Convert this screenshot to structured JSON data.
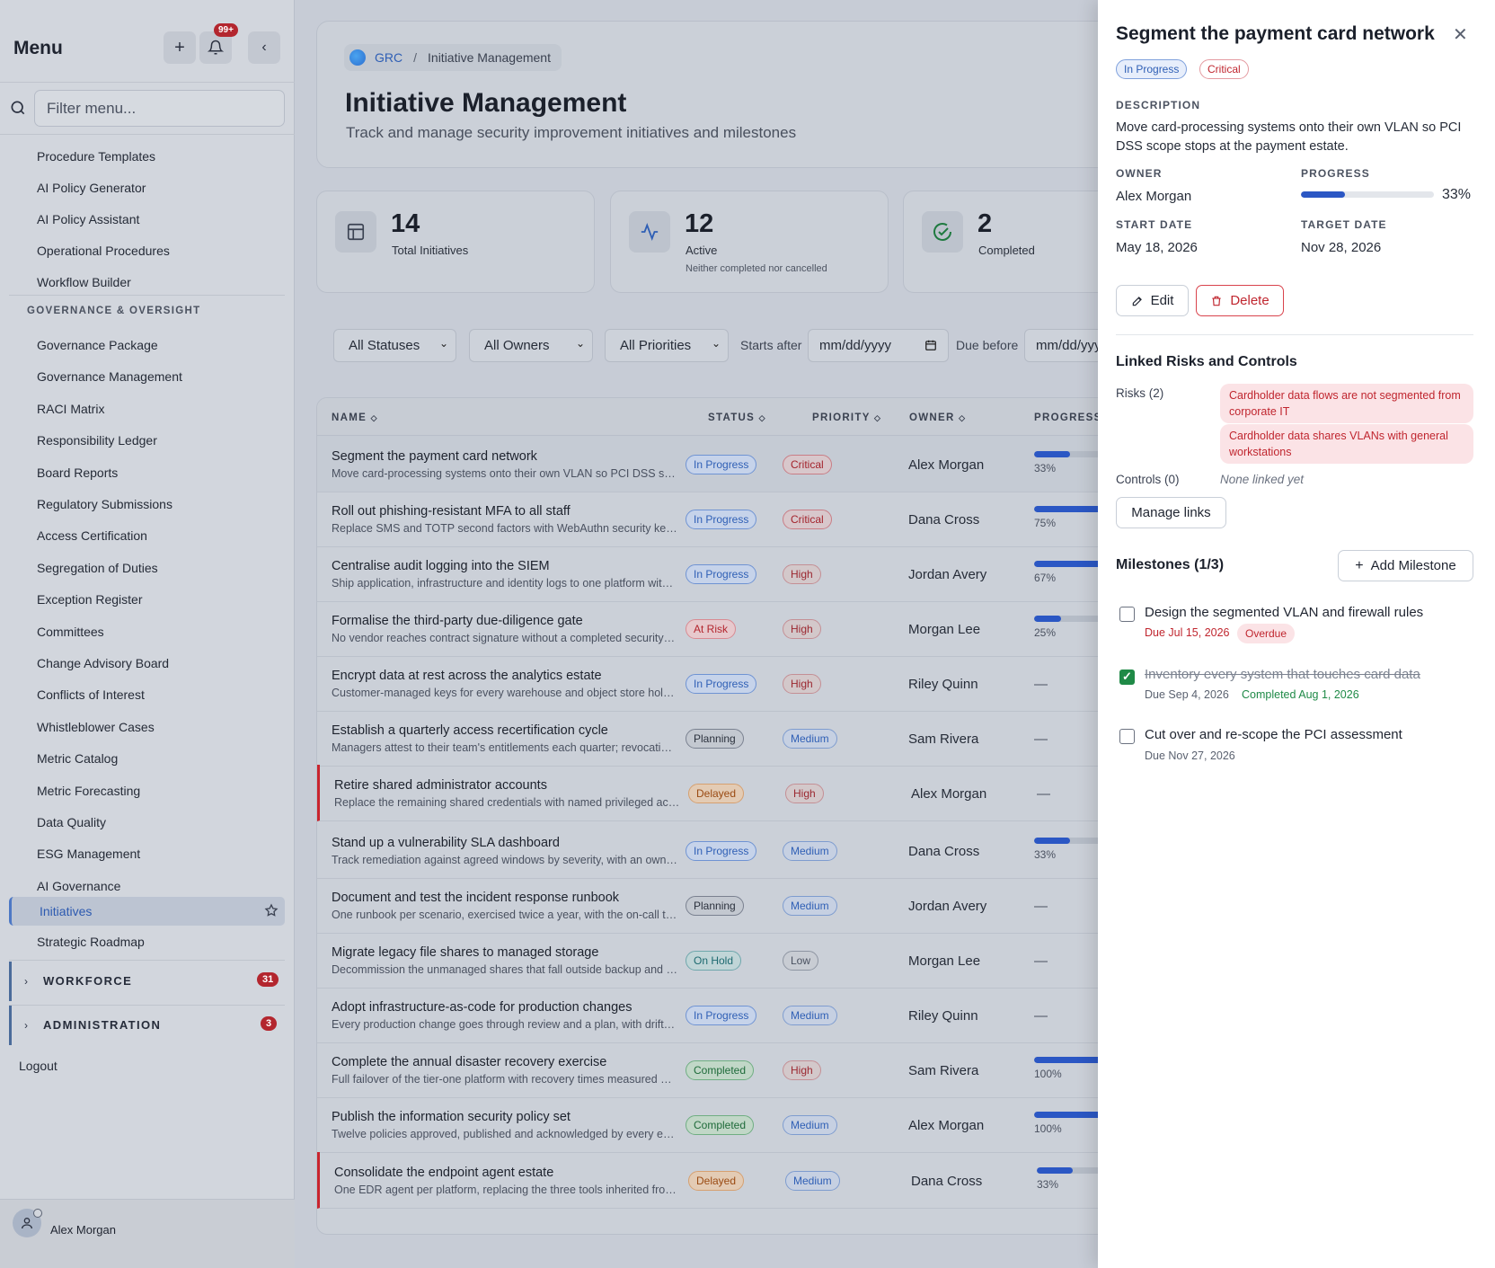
{
  "sidebar": {
    "title": "Menu",
    "notif_count": "99+",
    "filter_placeholder": "Filter menu...",
    "items_top": [
      "Procedure Templates",
      "AI Policy Generator",
      "AI Policy Assistant",
      "Operational Procedures",
      "Workflow Builder"
    ],
    "section_label": "GOVERNANCE & OVERSIGHT",
    "items_gov": [
      "Governance Package",
      "Governance Management",
      "RACI Matrix",
      "Responsibility Ledger",
      "Board Reports",
      "Regulatory Submissions",
      "Access Certification",
      "Segregation of Duties",
      "Exception Register",
      "Committees",
      "Change Advisory Board",
      "Conflicts of Interest",
      "Whistleblower Cases",
      "Metric Catalog",
      "Metric Forecasting",
      "Data Quality",
      "ESG Management",
      "AI Governance"
    ],
    "active_item": "Initiatives",
    "item_after_active": "Strategic Roadmap",
    "groups": [
      {
        "label": "WORKFORCE",
        "count": "31"
      },
      {
        "label": "ADMINISTRATION",
        "count": "3"
      }
    ],
    "logout": "Logout",
    "user_name": "Alex Morgan"
  },
  "header": {
    "breadcrumb_root": "GRC",
    "breadcrumb_sep": "/",
    "breadcrumb_current": "Initiative Management",
    "title": "Initiative Management",
    "subtitle": "Track and manage security improvement initiatives and milestones"
  },
  "stats": [
    {
      "value": "14",
      "label": "Total Initiatives",
      "hint": ""
    },
    {
      "value": "12",
      "label": "Active",
      "hint": "Neither completed nor cancelled"
    },
    {
      "value": "2",
      "label": "Completed",
      "hint": ""
    }
  ],
  "filters": {
    "status": "All Statuses",
    "owner": "All Owners",
    "priority": "All Priorities",
    "starts_after_label": "Starts after",
    "due_before_label": "Due before",
    "date_placeholder": "mm/dd/yyyy"
  },
  "table": {
    "headers": {
      "name": "NAME",
      "status": "STATUS",
      "priority": "PRIORITY",
      "owner": "OWNER",
      "progress": "PROGRESS"
    },
    "rows": [
      {
        "name": "Segment the payment card network",
        "desc": "Move card-processing systems onto their own VLAN so PCI DSS scope stops at the payment estate.",
        "status": "In Progress",
        "priority": "Critical",
        "owner": "Alex Morgan",
        "progress": 33,
        "progress_label": "33%",
        "flag": false
      },
      {
        "name": "Roll out phishing-resistant MFA to all staff",
        "desc": "Replace SMS and TOTP second factors with WebAuthn security keys for every account.",
        "status": "In Progress",
        "priority": "Critical",
        "owner": "Dana Cross",
        "progress": 75,
        "progress_label": "75%",
        "flag": false
      },
      {
        "name": "Centralise audit logging into the SIEM",
        "desc": "Ship application, infrastructure and identity logs to one platform with retention.",
        "status": "In Progress",
        "priority": "High",
        "owner": "Jordan Avery",
        "progress": 67,
        "progress_label": "67%",
        "flag": false
      },
      {
        "name": "Formalise the third-party due-diligence gate",
        "desc": "No vendor reaches contract signature without a completed security review.",
        "status": "At Risk",
        "priority": "High",
        "owner": "Morgan Lee",
        "progress": 25,
        "progress_label": "25%",
        "flag": false
      },
      {
        "name": "Encrypt data at rest across the analytics estate",
        "desc": "Customer-managed keys for every warehouse and object store holding data.",
        "status": "In Progress",
        "priority": "High",
        "owner": "Riley Quinn",
        "progress": null,
        "progress_label": "—",
        "flag": false
      },
      {
        "name": "Establish a quarterly access recertification cycle",
        "desc": "Managers attest to their team's entitlements each quarter; revocations tracked.",
        "status": "Planning",
        "priority": "Medium",
        "owner": "Sam Rivera",
        "progress": null,
        "progress_label": "—",
        "flag": false
      },
      {
        "name": "Retire shared administrator accounts",
        "desc": "Replace the remaining shared credentials with named privileged accounts.",
        "status": "Delayed",
        "priority": "High",
        "owner": "Alex Morgan",
        "progress": null,
        "progress_label": "—",
        "flag": true
      },
      {
        "name": "Stand up a vulnerability SLA dashboard",
        "desc": "Track remediation against agreed windows by severity, with an owner per item.",
        "status": "In Progress",
        "priority": "Medium",
        "owner": "Dana Cross",
        "progress": 33,
        "progress_label": "33%",
        "flag": false
      },
      {
        "name": "Document and test the incident response runbook",
        "desc": "One runbook per scenario, exercised twice a year, with the on-call team.",
        "status": "Planning",
        "priority": "Medium",
        "owner": "Jordan Avery",
        "progress": null,
        "progress_label": "—",
        "flag": false
      },
      {
        "name": "Migrate legacy file shares to managed storage",
        "desc": "Decommission the unmanaged shares that fall outside backup and retention.",
        "status": "On Hold",
        "priority": "Low",
        "owner": "Morgan Lee",
        "progress": null,
        "progress_label": "—",
        "flag": false
      },
      {
        "name": "Adopt infrastructure-as-code for production changes",
        "desc": "Every production change goes through review and a plan, with drift detection.",
        "status": "In Progress",
        "priority": "Medium",
        "owner": "Riley Quinn",
        "progress": null,
        "progress_label": "—",
        "flag": false
      },
      {
        "name": "Complete the annual disaster recovery exercise",
        "desc": "Full failover of the tier-one platform with recovery times measured and logged.",
        "status": "Completed",
        "priority": "High",
        "owner": "Sam Rivera",
        "progress": 100,
        "progress_label": "100%",
        "flag": false
      },
      {
        "name": "Publish the information security policy set",
        "desc": "Twelve policies approved, published and acknowledged by every employee.",
        "status": "Completed",
        "priority": "Medium",
        "owner": "Alex Morgan",
        "progress": 100,
        "progress_label": "100%",
        "flag": false
      },
      {
        "name": "Consolidate the endpoint agent estate",
        "desc": "One EDR agent per platform, replacing the three tools inherited from mergers.",
        "status": "Delayed",
        "priority": "Medium",
        "owner": "Dana Cross",
        "progress": 33,
        "progress_label": "33%",
        "flag": true
      }
    ]
  },
  "drawer": {
    "title": "Segment the payment card network",
    "status": "In Progress",
    "priority": "Critical",
    "description_label": "DESCRIPTION",
    "description": "Move card-processing systems onto their own VLAN so PCI DSS scope stops at the payment estate.",
    "owner_label": "OWNER",
    "owner": "Alex Morgan",
    "progress_label": "PROGRESS",
    "progress": 33,
    "progress_text": "33%",
    "start_label": "START DATE",
    "start": "May 18, 2026",
    "target_label": "TARGET DATE",
    "target": "Nov 28, 2026",
    "edit": "Edit",
    "delete": "Delete",
    "linked_title": "Linked Risks and Controls",
    "risks_label": "Risks (2)",
    "risks": [
      "Cardholder data flows are not segmented from corporate IT",
      "Cardholder data shares VLANs with general workstations"
    ],
    "controls_label": "Controls (0)",
    "controls_empty": "None linked yet",
    "manage_links": "Manage links",
    "milestones_title": "Milestones (1/3)",
    "add_milestone": "Add Milestone",
    "milestones": [
      {
        "title": "Design the segmented VLAN and firewall rules",
        "due": "Due Jul 15, 2026",
        "tag": "Overdue",
        "done": false
      },
      {
        "title": "Inventory every system that touches card data",
        "due": "Due Sep 4, 2026",
        "tag": "Completed Aug 1, 2026",
        "done": true
      },
      {
        "title": "Cut over and re-scope the PCI assessment",
        "due": "Due Nov 27, 2026",
        "tag": "",
        "done": false
      }
    ]
  },
  "colors": {
    "accent": "#2f5fb5",
    "critical": "#c0262f",
    "success": "#1f8a47",
    "progress_fill": "#2b57c4"
  }
}
